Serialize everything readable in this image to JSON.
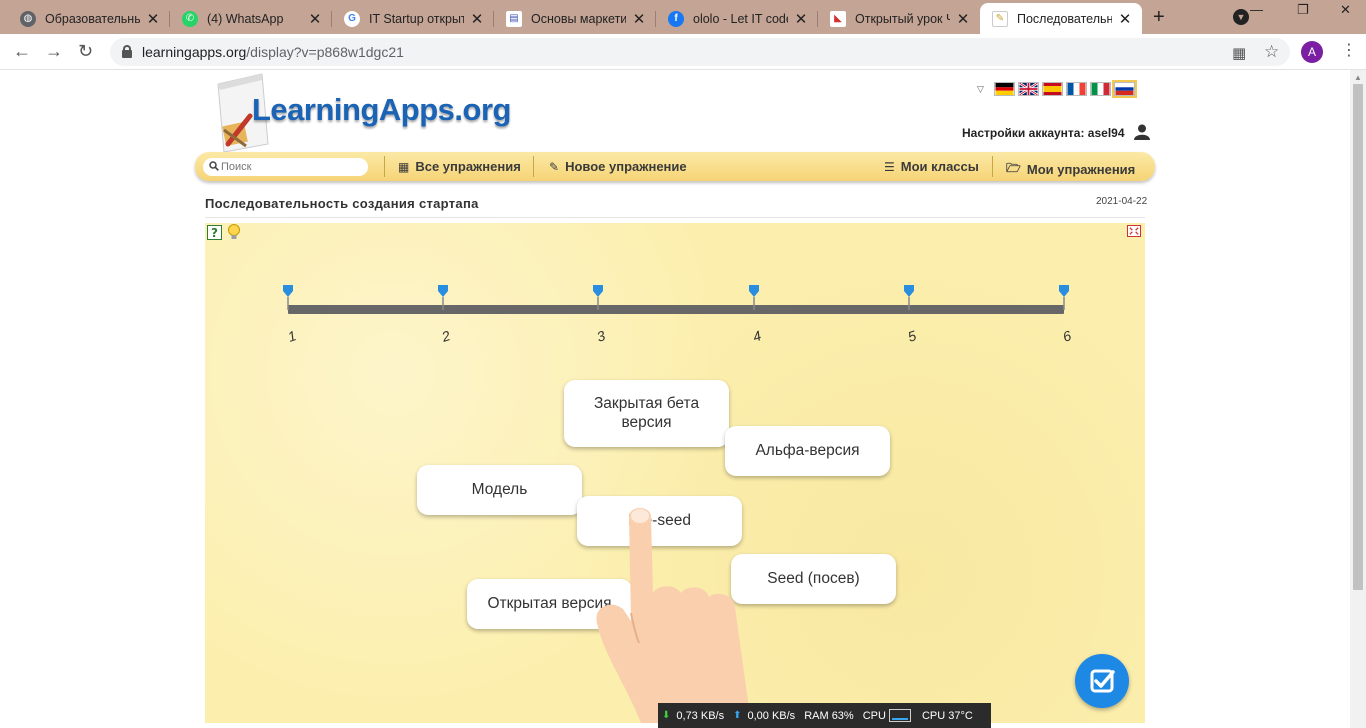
{
  "browser": {
    "tabs": [
      {
        "title": "Образовательный",
        "favicon": "globe-icon",
        "color": "#5f6368",
        "active": false
      },
      {
        "title": "(4) WhatsApp",
        "favicon": "whatsapp-icon",
        "color": "#25d366",
        "active": false
      },
      {
        "title": "IT Startup открыт",
        "favicon": "google-icon",
        "color": "#4285f4",
        "active": false
      },
      {
        "title": "Основы маркетин",
        "favicon": "document-icon",
        "color": "#3f51b5",
        "active": false
      },
      {
        "title": "ololo - Let IT code",
        "favicon": "facebook-icon",
        "color": "#1877f2",
        "active": false
      },
      {
        "title": "Открытый урок Ч",
        "favicon": "bookmark-icon",
        "color": "#d32f2f",
        "active": false
      },
      {
        "title": "Последовательнос",
        "favicon": "learningapps-icon",
        "color": "#f4c542",
        "active": true
      }
    ],
    "url_host": "learningapps.org",
    "url_path": "/display?v=p868w1dgc21",
    "avatar_letter": "A",
    "avatar_color": "#7b1fa2"
  },
  "site": {
    "logo_text": "LearningApps.org",
    "account_text": "Настройки аккаунта: asel94",
    "search_placeholder": "Поиск",
    "nav": {
      "all_exercises": "Все упражнения",
      "new_exercise": "Новое упражнение",
      "my_classes": "Мои классы",
      "my_exercises": "Мои упражнения"
    },
    "languages": [
      "de",
      "en",
      "es",
      "fr",
      "it",
      "ru"
    ]
  },
  "app": {
    "title": "Последовательность создания стартапа",
    "date": "2021-04-22",
    "timeline_labels": [
      "1",
      "2",
      "3",
      "4",
      "5",
      "6"
    ],
    "cards": [
      {
        "text": "Закрытая бета версия"
      },
      {
        "text": "Альфа-версия"
      },
      {
        "text": "Модель"
      },
      {
        "text": "Pre-seed"
      },
      {
        "text": "Seed (посев)"
      },
      {
        "text": "Открытая версия"
      }
    ]
  },
  "monitor": {
    "down": "0,73 KB/s",
    "up": "0,00 KB/s",
    "ram": "RAM 63%",
    "cpu_label": "CPU",
    "cpu_temp": "CPU 37°C"
  },
  "colors": {
    "accent_blue": "#1e88e5",
    "navbar_yellow": "#f6d476",
    "canvas_yellow": "#fcefae",
    "timeline_gray": "#676767"
  }
}
